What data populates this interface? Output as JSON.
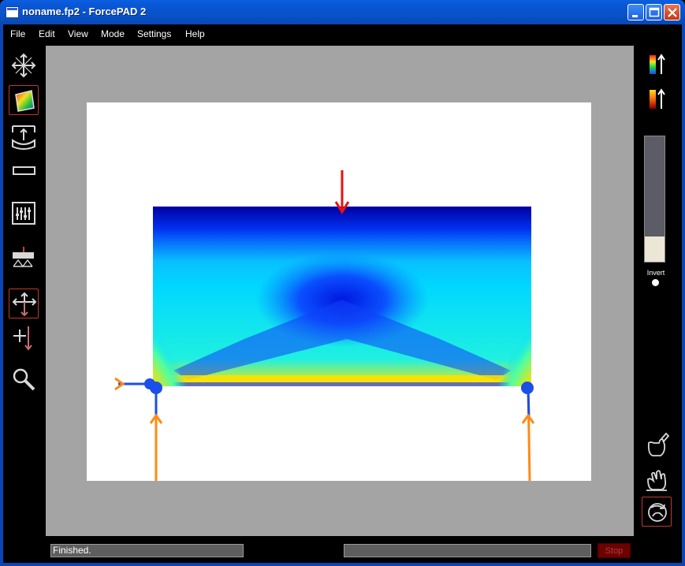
{
  "window": {
    "title": "noname.fp2 - ForcePAD 2"
  },
  "menu": {
    "items": [
      {
        "label": "File"
      },
      {
        "label": "Edit"
      },
      {
        "label": "View"
      },
      {
        "label": "Mode"
      },
      {
        "label": "Settings"
      },
      {
        "label": "Help"
      }
    ]
  },
  "left_toolbar": {
    "tools": [
      {
        "icon": "transform-arrows-icon",
        "selected": false
      },
      {
        "icon": "color-square-icon",
        "selected": true
      },
      {
        "icon": "stretch-box-icon",
        "selected": false
      },
      {
        "icon": "rectangle-icon",
        "selected": false
      },
      {
        "icon": "sliders-panel-icon",
        "selected": false
      },
      {
        "icon": "support-beam-icon",
        "selected": false
      },
      {
        "icon": "move-arrows-icon",
        "selected": true
      },
      {
        "icon": "force-arrow-icon",
        "selected": false
      },
      {
        "icon": "magnifier-icon",
        "selected": false
      }
    ]
  },
  "right_toolbar": {
    "tools": [
      {
        "icon": "color-scale-up-icon"
      },
      {
        "icon": "heat-scale-up-icon"
      }
    ],
    "bottom_tools": [
      {
        "icon": "hand-paint-icon",
        "selected": false
      },
      {
        "icon": "hand-grab-icon",
        "selected": false
      },
      {
        "icon": "hand-rotate-icon",
        "selected": true
      }
    ],
    "slider_level": 0.2,
    "invert_label": "Invert"
  },
  "status": {
    "text": "Finished.",
    "stop_label": "Stop"
  },
  "colors": {
    "load_arrow": "#e81010",
    "support_arrow": "#ff8a16",
    "support_node": "#1a4fe8",
    "canvas_bg": "#a4a4a4"
  }
}
